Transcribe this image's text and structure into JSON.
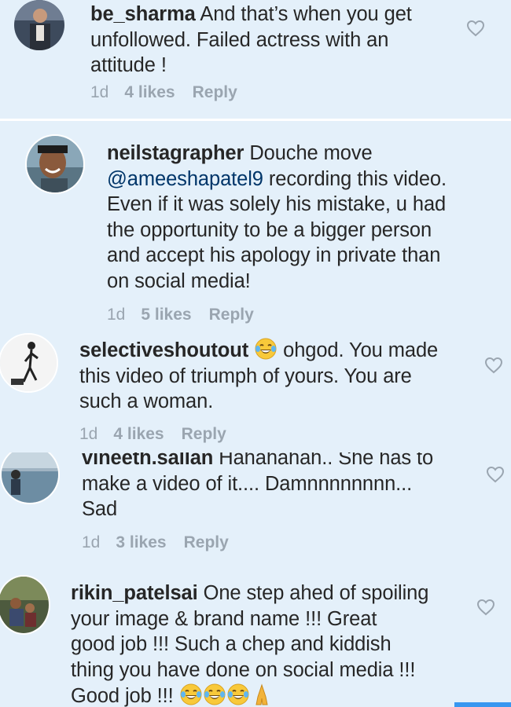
{
  "comments": [
    {
      "username": "be_sharma",
      "text": "And that’s when you get unfollowed. Failed actress with an attitude !",
      "line1": "And that’s when you get",
      "line2": "unfollowed. Failed actress with an",
      "line3": "attitude !",
      "time": "1d",
      "likes": "4 likes",
      "reply": "Reply"
    },
    {
      "username": "neilstagrapher",
      "text_before": "Douche move",
      "mention": "@ameeshapatel9",
      "text_after": "recording this video. Even if it was solely his mistake, u had the opportunity to be a bigger person and accept his apology in private than on social media!",
      "l2after": " recording this video.",
      "l3": "Even if it was solely his mistake, u had",
      "l4": "the opportunity to be a bigger person",
      "l5": "and accept his apology in private than",
      "l6": "on social media!",
      "time": "1d",
      "likes": "5 likes",
      "reply": "Reply"
    },
    {
      "username": "selectiveshoutout",
      "text_after_emoji": "ohgod. You made",
      "l2": "this video of triumph of yours. You are",
      "l3": "such a woman.",
      "time": "1d",
      "likes": "4 likes",
      "reply": "Reply"
    },
    {
      "username": "vineeth.sallan",
      "l1_after": "Hahahahah.. She has to",
      "l2": "make a video of it.... Damnnnnnnnn...",
      "l3": "Sad",
      "time": "1d",
      "likes": "3 likes",
      "reply": "Reply"
    },
    {
      "username": "rikin_patelsai",
      "l1_after": "One step ahed of spoiling",
      "l2": "your image & brand name !!! Great",
      "l3": "good job !!! Such a chep and kiddish",
      "l4": "thing you have done on social media !!!",
      "l5_before": "Good job !!!"
    }
  ],
  "icons": {
    "heart": "heart-outline-icon",
    "laugh": "face-with-tears-of-joy-emoji",
    "pray": "folded-hands-emoji"
  },
  "colors": {
    "background": "#e4f0fa",
    "text": "#262626",
    "mention": "#003569",
    "meta": "#9aa5b0",
    "accent": "#3897f0"
  }
}
